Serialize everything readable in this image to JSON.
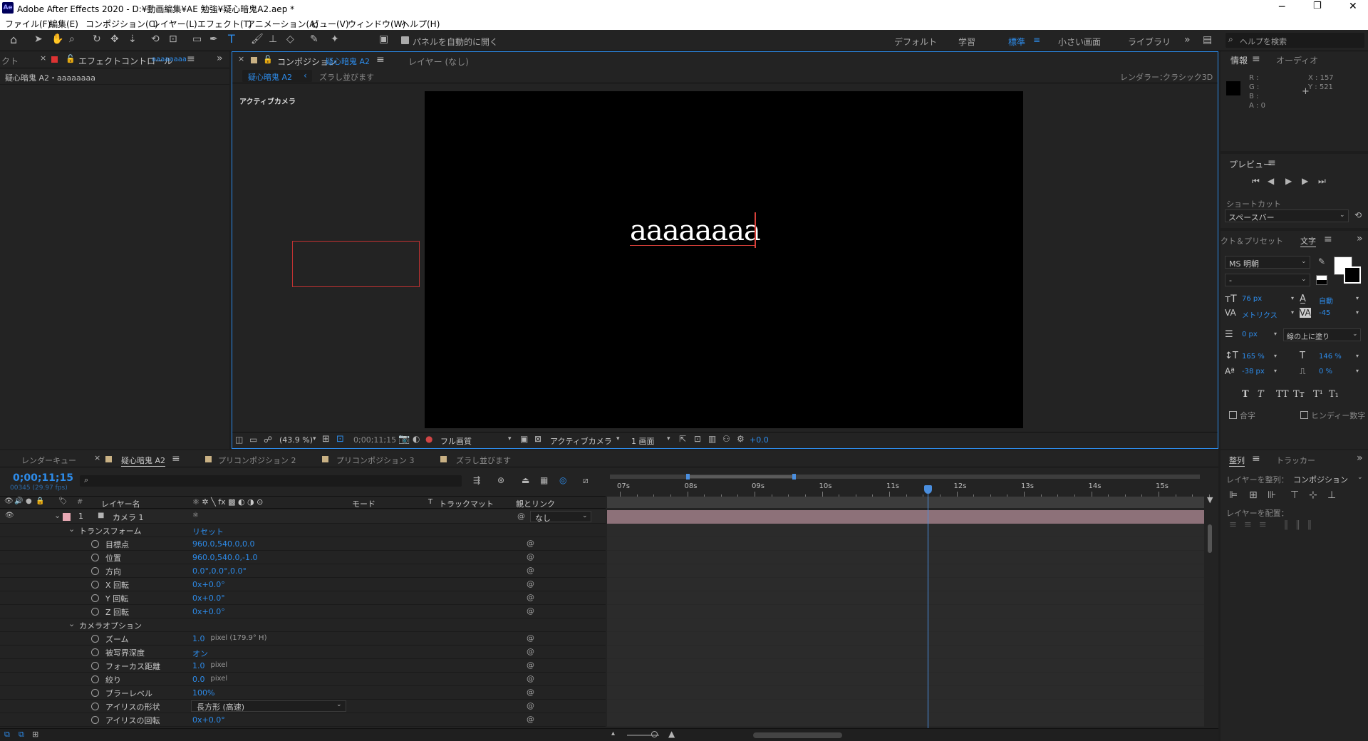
{
  "window": {
    "title": "Adobe After Effects 2020 - D:¥動画編集¥AE 勉強¥疑心暗鬼A2.aep *",
    "app_badge": "Ae"
  },
  "menu": [
    "ファイル(F)",
    "編集(E)",
    "コンポジション(C)",
    "レイヤー(L)",
    "エフェクト(T)",
    "アニメーション(A)",
    "ビュー(V)",
    "ウィンドウ(W)",
    "ヘルプ(H)"
  ],
  "toolbar": {
    "auto_open_label": "パネルを自動的に開く",
    "workspaces": [
      "デフォルト",
      "学習",
      "標準",
      "小さい画面",
      "ライブラリ"
    ],
    "active_workspace": "標準",
    "search_placeholder": "ヘルプを検索"
  },
  "effects_panel": {
    "cut_tab": "クト",
    "tab": "エフェクトコントロール",
    "tab_layer": "aaaaaaaa",
    "subtitle": "疑心暗鬼 A2・aaaaaaaa"
  },
  "comp_panel": {
    "tab_prefix": "コンポジション",
    "tab_name": "疑心暗鬼 A2",
    "layer_tab": "レイヤー (なし)",
    "crumb_active": "疑心暗鬼 A2",
    "crumb_other": "ズラし並びます",
    "renderer_label": "レンダラー：",
    "renderer_value": "クラシック3D",
    "camera_label": "アクティブカメラ",
    "text_content": "aaaaaaaa",
    "footer": {
      "zoom": "(43.9 %)",
      "timecode": "0;00;11;15",
      "quality": "フル画質",
      "camera": "アクティブカメラ",
      "views": "1 画面",
      "exposure": "+0.0"
    }
  },
  "info_panel": {
    "tab_info": "情報",
    "tab_audio": "オーディオ",
    "r": "R :",
    "g": "G :",
    "b": "B :",
    "a": "A : 0",
    "x": "X : 157",
    "y": "Y : 521"
  },
  "preview_panel": {
    "title": "プレビュー",
    "shortcut_label": "ショートカット",
    "shortcut_value": "スペースバー"
  },
  "char_panel": {
    "left_tab": "クト＆プリセット",
    "tab": "文字",
    "font": "MS 明朝",
    "style": "-",
    "size": "76 px",
    "leading": "自動",
    "kerning": "メトリクス",
    "tracking": "-45",
    "stroke": "0 px",
    "stroke_mode": "線の上に塗り",
    "vscale": "165 %",
    "hscale": "146 %",
    "baseline": "-38 px",
    "tsume": "0 %",
    "ligature": "合字",
    "hindi": "ヒンディー数字"
  },
  "align_panel": {
    "tab": "整列",
    "tab2": "トラッカー",
    "align_to_label": "レイヤーを整列：",
    "align_to_value": "コンポジション",
    "distribute_label": "レイヤーを配置："
  },
  "timeline": {
    "tabs": [
      "レンダーキュー",
      "疑心暗鬼 A2",
      "プリコンポジション 2",
      "プリコンポジション 3",
      "ズラし並びます"
    ],
    "timecode": "0;00;11;15",
    "frames": "00345 (29.97 fps)",
    "headers": {
      "num": "#",
      "layer_name": "レイヤー名",
      "mode": "モード",
      "t": "T",
      "trackmatte": "トラックマット",
      "parent": "親とリンク"
    },
    "layer": {
      "num": "1",
      "name": "カメラ 1",
      "parent": "なし"
    },
    "ruler": [
      "07s",
      "08s",
      "09s",
      "10s",
      "11s",
      "12s",
      "13s",
      "14s",
      "15s"
    ],
    "transform_label": "トランスフォーム",
    "reset": "リセット",
    "camera_options_label": "カメラオプション",
    "props": [
      {
        "name": "目標点",
        "value": "960.0,540.0,0.0",
        "unit": ""
      },
      {
        "name": "位置",
        "value": "960.0,540.0,-1.0",
        "unit": ""
      },
      {
        "name": "方向",
        "value": "0.0°,0.0°,0.0°",
        "unit": ""
      },
      {
        "name": "X 回転",
        "value": "0x+0.0°",
        "unit": ""
      },
      {
        "name": "Y 回転",
        "value": "0x+0.0°",
        "unit": ""
      },
      {
        "name": "Z 回転",
        "value": "0x+0.0°",
        "unit": ""
      }
    ],
    "cam_props": [
      {
        "name": "ズーム",
        "value": "1.0",
        "unit": "pixel (179.9° H)"
      },
      {
        "name": "被写界深度",
        "value": "オン",
        "unit": ""
      },
      {
        "name": "フォーカス距離",
        "value": "1.0",
        "unit": "pixel"
      },
      {
        "name": "絞り",
        "value": "0.0",
        "unit": "pixel"
      },
      {
        "name": "ブラーレベル",
        "value": "100%",
        "unit": ""
      },
      {
        "name": "アイリスの形状",
        "value": "長方形 (高速)",
        "unit": ""
      },
      {
        "name": "アイリスの回転",
        "value": "0x+0.0°",
        "unit": ""
      }
    ]
  },
  "colors": {
    "accent": "#2d8ceb",
    "layer_label": "#e8a9b4",
    "track_bar": "#8d7179",
    "bg": "#1d1d1d",
    "panel": "#232323"
  }
}
